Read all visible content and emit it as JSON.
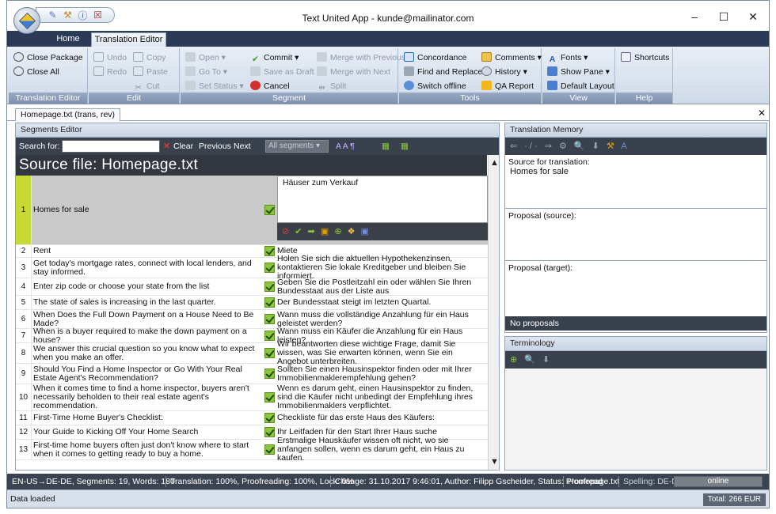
{
  "window": {
    "title": "Text United App - kunde@mailinator.com",
    "minimize": "–",
    "maximize": "☐",
    "close": "✕"
  },
  "ribbon_tabs": [
    "Home",
    "Translation Editor"
  ],
  "ribbon": {
    "translation_editor": {
      "label": "Translation Editor",
      "close_package": "Close Package",
      "close_all": "Close All"
    },
    "edit": {
      "label": "Edit",
      "undo": "Undo",
      "redo": "Redo",
      "copy": "Copy",
      "paste": "Paste",
      "cut": "Cut"
    },
    "segment": {
      "label": "Segment",
      "open": "Open",
      "go_to": "Go To",
      "set_status": "Set Status",
      "commit": "Commit",
      "save_as_draft": "Save as Draft",
      "cancel": "Cancel",
      "merge_previous": "Merge with Previous",
      "merge_next": "Merge with Next",
      "split": "Split"
    },
    "tools": {
      "label": "Tools",
      "concordance": "Concordance",
      "find_replace": "Find and Replace",
      "switch_offline": "Switch offline",
      "comments": "Comments",
      "history": "History",
      "qa_report": "QA Report"
    },
    "view": {
      "label": "View",
      "fonts": "Fonts",
      "show_pane": "Show Pane",
      "default_layout": "Default Layout"
    },
    "help": {
      "label": "Help",
      "shortcuts": "Shortcuts"
    }
  },
  "doc_tab": "Homepage.txt (trans, rev)",
  "segments_editor": {
    "title": "Segments Editor",
    "search_label": "Search for:",
    "search_value": "",
    "clear": "Clear",
    "previous": "Previous",
    "next": "Next",
    "filter": "All segments",
    "source_file": "Source file: Homepage.txt",
    "editing_target": "Häuser zum Verkauf",
    "rows": [
      {
        "n": "1",
        "src": "Homes for sale",
        "tgt": ""
      },
      {
        "n": "2",
        "src": "Rent",
        "tgt": "Miete"
      },
      {
        "n": "3",
        "src": "Get today's mortgage rates, connect with local lenders, and stay informed.",
        "tgt": "Holen Sie sich die aktuellen Hypothekenzinsen, kontaktieren Sie lokale Kreditgeber und bleiben Sie informiert."
      },
      {
        "n": "4",
        "src": "Enter zip code or choose your state from the list",
        "tgt": "Geben Sie die Postleitzahl ein oder wählen Sie Ihren Bundesstaat aus der Liste aus"
      },
      {
        "n": "5",
        "src": "The state of sales is increasing in the last quarter.",
        "tgt": "Der Bundesstaat steigt im letzten Quartal."
      },
      {
        "n": "6",
        "src": "When Does the Full Down Payment on a House Need to Be Made?",
        "tgt": "Wann muss die vollständige Anzahlung für ein Haus geleistet werden?"
      },
      {
        "n": "7",
        "src": "When is a buyer required to make the down payment on a house?",
        "tgt": "Wann muss ein Käufer die Anzahlung für ein Haus leisten?"
      },
      {
        "n": "8",
        "src": "We answer this crucial question so you know what to expect when you make an offer.",
        "tgt": "Wir beantworten diese wichtige Frage, damit Sie wissen, was Sie erwarten können, wenn Sie ein Angebot unterbreiten."
      },
      {
        "n": "9",
        "src": "Should You Find a Home Inspector or Go With Your Real Estate Agent's Recommendation?",
        "tgt": "Sollten Sie einen Hausinspektor finden oder mit Ihrer Immobilienmaklerempfehlung gehen?"
      },
      {
        "n": "10",
        "src": "When it comes time to find a home inspector, buyers aren't necessarily beholden to their real estate agent's recommendation.",
        "tgt": "Wenn es darum geht, einen Hausinspektor zu finden, sind die Käufer nicht unbedingt der Empfehlung ihres Immobilienmaklers verpflichtet."
      },
      {
        "n": "11",
        "src": "First-Time Home Buyer's Checklist:",
        "tgt": "Checkliste für das erste Haus des Käufers:"
      },
      {
        "n": "12",
        "src": "Your Guide to Kicking Off Your Home Search",
        "tgt": "Ihr Leitfaden für den Start Ihrer Haus suche"
      },
      {
        "n": "13",
        "src": "First-time home buyers often just don't know where to start when it comes to getting ready to buy a home.",
        "tgt": "Erstmalige Hauskäufer wissen oft nicht, wo sie anfangen sollen, wenn es darum geht, ein Haus zu kaufen."
      }
    ]
  },
  "translation_memory": {
    "title": "Translation Memory",
    "source_label": "Source for translation:",
    "source_value": "Homes for sale",
    "proposal_source": "Proposal (source):",
    "proposal_target": "Proposal (target):",
    "no_proposals": "No proposals"
  },
  "terminology": {
    "title": "Terminology"
  },
  "status": {
    "langs": "EN-US→DE-DE, Segments: 19, Words: 180",
    "progress": "Translation: 100%, Proofreading: 100%, Lock: 0%",
    "change": "Change: 31.10.2017 9:46:01, Author: Filipp Gscheider, Status: Proofread",
    "file": "Homepage.txt",
    "spelling": "Spelling:  DE-DE",
    "online": "online"
  },
  "bottom": {
    "message": "Data loaded",
    "total": "Total: 266 EUR"
  }
}
